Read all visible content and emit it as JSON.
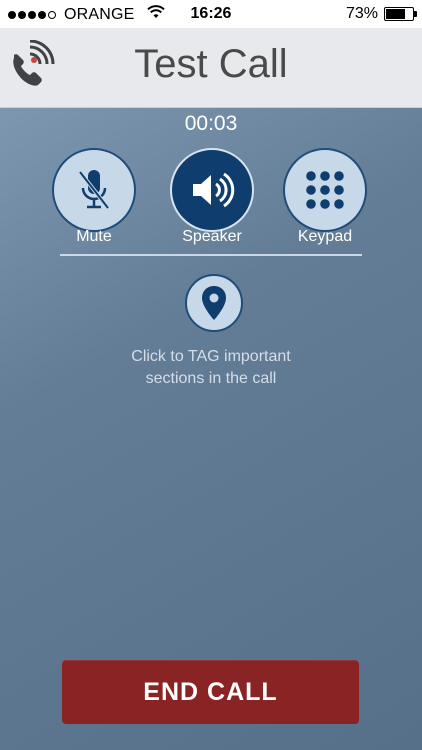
{
  "status_bar": {
    "carrier": "ORANGE",
    "time": "16:26",
    "battery_percent": "73%",
    "battery_level": 0.73,
    "signal_bars_filled": 4,
    "signal_bars_total": 5
  },
  "header": {
    "title": "Test Call",
    "logo_icon": "phone-waves-icon"
  },
  "call": {
    "timer": "00:03",
    "controls": [
      {
        "label": "Mute",
        "icon": "microphone-muted-icon",
        "active": false
      },
      {
        "label": "Speaker",
        "icon": "speaker-icon",
        "active": true
      },
      {
        "label": "Keypad",
        "icon": "keypad-icon",
        "active": false
      }
    ],
    "tag_icon": "location-pin-icon",
    "tag_text_line1": "Click to TAG important",
    "tag_text_line2": "sections in the call"
  },
  "end_call_label": "END CALL",
  "colors": {
    "header_bg": "#e7e9ec",
    "content_bg": "#5a7088",
    "button_light": "#c7d8e8",
    "button_dark": "#0f3e6e",
    "end_call": "#8a2424"
  }
}
